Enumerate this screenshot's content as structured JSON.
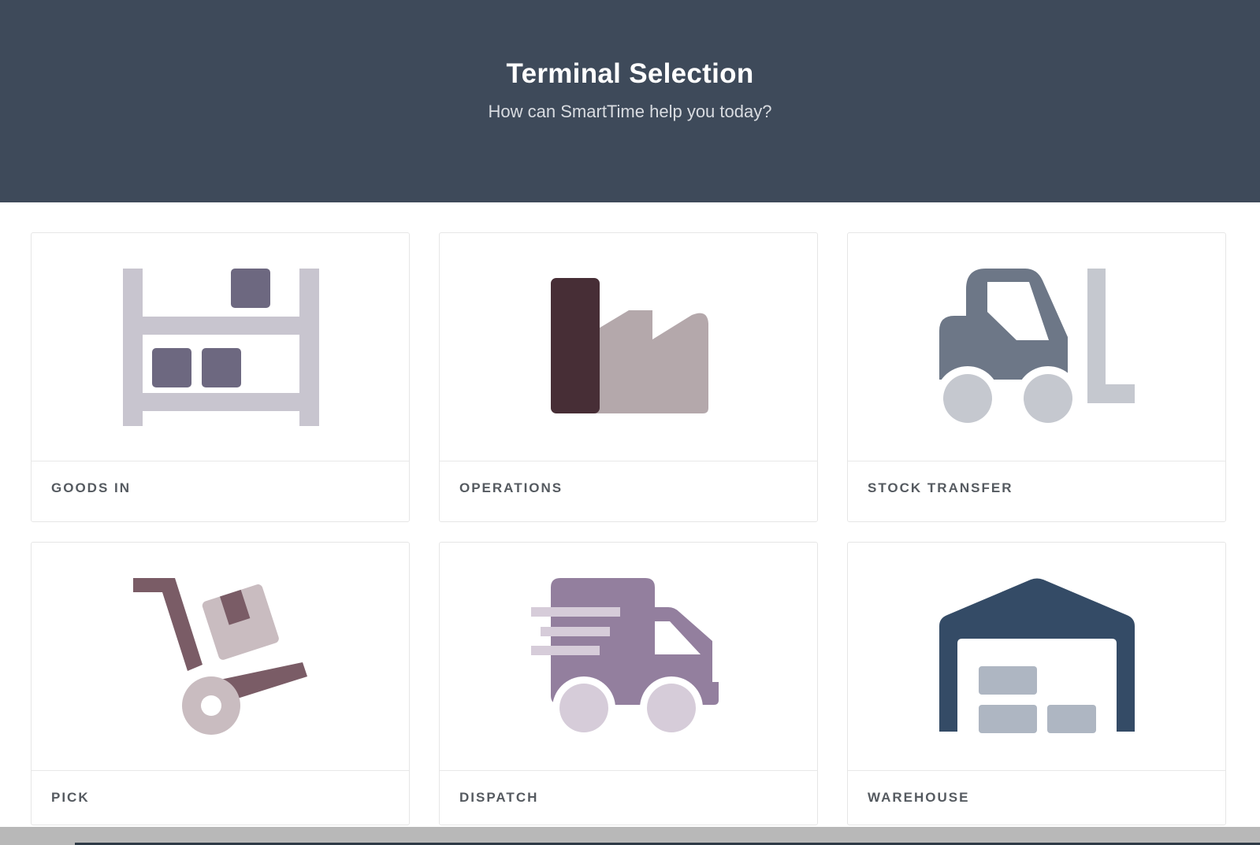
{
  "header": {
    "title": "Terminal Selection",
    "subtitle": "How can SmartTime help you today?"
  },
  "tiles": [
    {
      "label": "GOODS IN",
      "icon": "shelving-boxes-icon"
    },
    {
      "label": "OPERATIONS",
      "icon": "factory-icon"
    },
    {
      "label": "STOCK TRANSFER",
      "icon": "forklift-icon"
    },
    {
      "label": "PICK",
      "icon": "hand-truck-icon"
    },
    {
      "label": "DISPATCH",
      "icon": "delivery-van-icon"
    },
    {
      "label": "WAREHOUSE",
      "icon": "warehouse-icon"
    }
  ],
  "colors": {
    "header_bg": "#3e4a5a",
    "tile_label": "#555a60"
  }
}
